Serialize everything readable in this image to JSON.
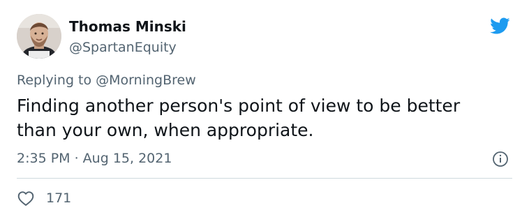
{
  "author": {
    "name": "Thomas Minski",
    "handle": "@SpartanEquity"
  },
  "reply": {
    "prefix": "Replying to ",
    "target": "@MorningBrew"
  },
  "tweet": {
    "text": "Finding another person's point of view to be better\nthan your own, when appropriate."
  },
  "meta": {
    "timestamp": "2:35 PM · Aug 15, 2021"
  },
  "engagement": {
    "likes": "171"
  },
  "icons": {
    "brand": "twitter-bird-icon",
    "info": "info-icon",
    "like": "heart-outline-icon"
  },
  "colors": {
    "brand": "#1d9bf0",
    "text": "#0f1419",
    "secondary": "#536471",
    "divider": "#cfd9de"
  }
}
